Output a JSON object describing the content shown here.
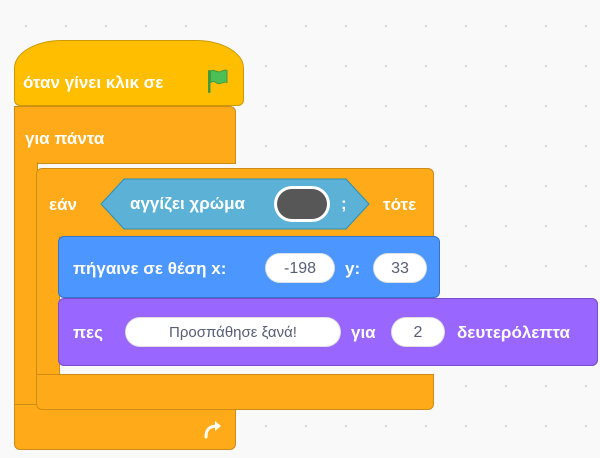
{
  "script": {
    "hat": {
      "label": "όταν γίνει κλικ σε",
      "icon": "green-flag-icon",
      "color": "#ffbf00"
    },
    "forever": {
      "label": "για πάντα",
      "loop_icon": "loop-arrow-icon",
      "color": "#ffab19"
    },
    "if_block": {
      "if_label": "εάν",
      "then_label": "τότε",
      "condition": {
        "label": "αγγίζει χρώμα",
        "color_swatch": "#575757",
        "suffix": ";",
        "color": "#5cb1d6"
      }
    },
    "goto_block": {
      "label": "πήγαινε σε θέση x:",
      "x_value": "-198",
      "y_label": "y:",
      "y_value": "33",
      "color": "#4c97ff"
    },
    "say_block": {
      "label": "πες",
      "message": "Προσπάθησε ξανά!",
      "for_label": "για",
      "seconds": "2",
      "seconds_label": "δευτερόλεπτα",
      "color": "#9966ff"
    }
  }
}
